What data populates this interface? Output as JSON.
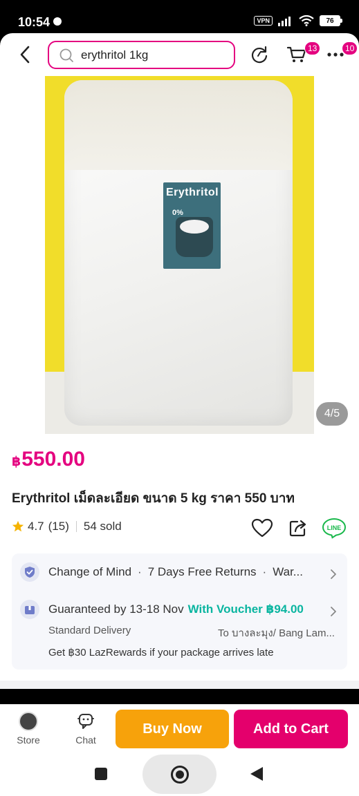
{
  "status_bar": {
    "time": "10:54",
    "vpn": "VPN",
    "battery": "76"
  },
  "header": {
    "search_value": "erythritol 1kg",
    "cart_badge": "13",
    "more_badge": "10",
    "icons": [
      "back-arrow-icon",
      "search-icon",
      "refresh-icon",
      "cart-icon",
      "more-icon"
    ]
  },
  "gallery": {
    "counter": "4/5",
    "product_label_title": "Erythritol",
    "product_label_zero": "0%"
  },
  "product": {
    "currency": "฿",
    "price": "550.00",
    "title": "Erythritol เม็ดละเอียด ขนาด 5 kg ราคา 550 บาท",
    "rating": "4.7",
    "reviews": "(15)",
    "sold": "54 sold"
  },
  "services": {
    "returns_1": "Change of Mind",
    "returns_2": "7 Days Free Returns",
    "returns_3": "War...",
    "delivery_guarantee": "Guaranteed by 13-18 Nov",
    "voucher": "With Voucher ฿94.00",
    "delivery_type": "Standard Delivery",
    "delivery_to": "To บางละมุง/ Bang Lam...",
    "rewards": "Get ฿30 LazRewards if your package arrives late"
  },
  "bottom_bar": {
    "store_label": "Store",
    "chat_label": "Chat",
    "buy_now": "Buy Now",
    "add_to_cart": "Add to Cart"
  },
  "colors": {
    "brand_pink": "#e4007f",
    "buy_now_orange": "#f7a20b",
    "voucher_green": "#0ab5a0"
  }
}
